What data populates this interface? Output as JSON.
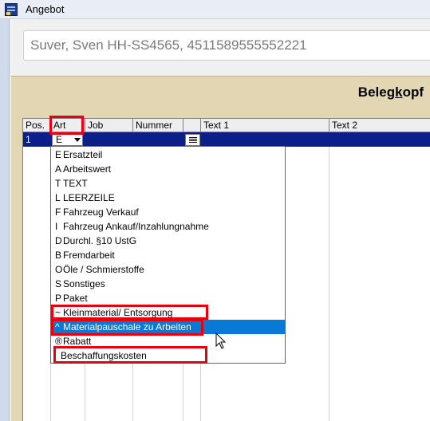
{
  "window": {
    "title": "Angebot",
    "icon": "app-icon"
  },
  "header": {
    "customer_field": "Suver, Sven HH-SS4565, 4511589555552221"
  },
  "panel": {
    "title_prefix": "Beleg",
    "title_mnemonic": "k",
    "title_suffix": "opf"
  },
  "grid": {
    "columns": [
      "Pos.",
      "Art",
      "Job",
      "Nummer",
      "",
      "Text 1",
      "Text 2"
    ],
    "row": {
      "pos": "1",
      "art": "E"
    }
  },
  "dropdown": {
    "selected_index": 13,
    "options": [
      {
        "code": "E",
        "label": "Ersatzteil"
      },
      {
        "code": "A",
        "label": "Arbeitswert"
      },
      {
        "code": "T",
        "label": "TEXT"
      },
      {
        "code": "L",
        "label": "LEERZEILE"
      },
      {
        "code": "F",
        "label": "Fahrzeug Verkauf"
      },
      {
        "code": "I",
        "label": "Fahrzeug Ankauf/Inzahlungnahme"
      },
      {
        "code": "D",
        "label": "Durchl. §10 UstG"
      },
      {
        "code": "B",
        "label": "Fremdarbeit"
      },
      {
        "code": "O",
        "label": "Öle / Schmierstoffe"
      },
      {
        "code": "S",
        "label": "Sonstiges"
      },
      {
        "code": "P",
        "label": "Paket"
      },
      {
        "code": "~",
        "label": "Kleinmaterial/ Entsorgung"
      },
      {
        "code": "^",
        "label": "Materialpauschale zu Arbeiten"
      },
      {
        "code": "®",
        "label": "Rabatt"
      },
      {
        "code": "",
        "label": "Beschaffungskosten"
      }
    ]
  },
  "colors": {
    "selection_row": "#0a1f8a",
    "list_highlight": "#0a78d7",
    "annotation": "#e3000f",
    "panel": "#e2d7b2"
  }
}
